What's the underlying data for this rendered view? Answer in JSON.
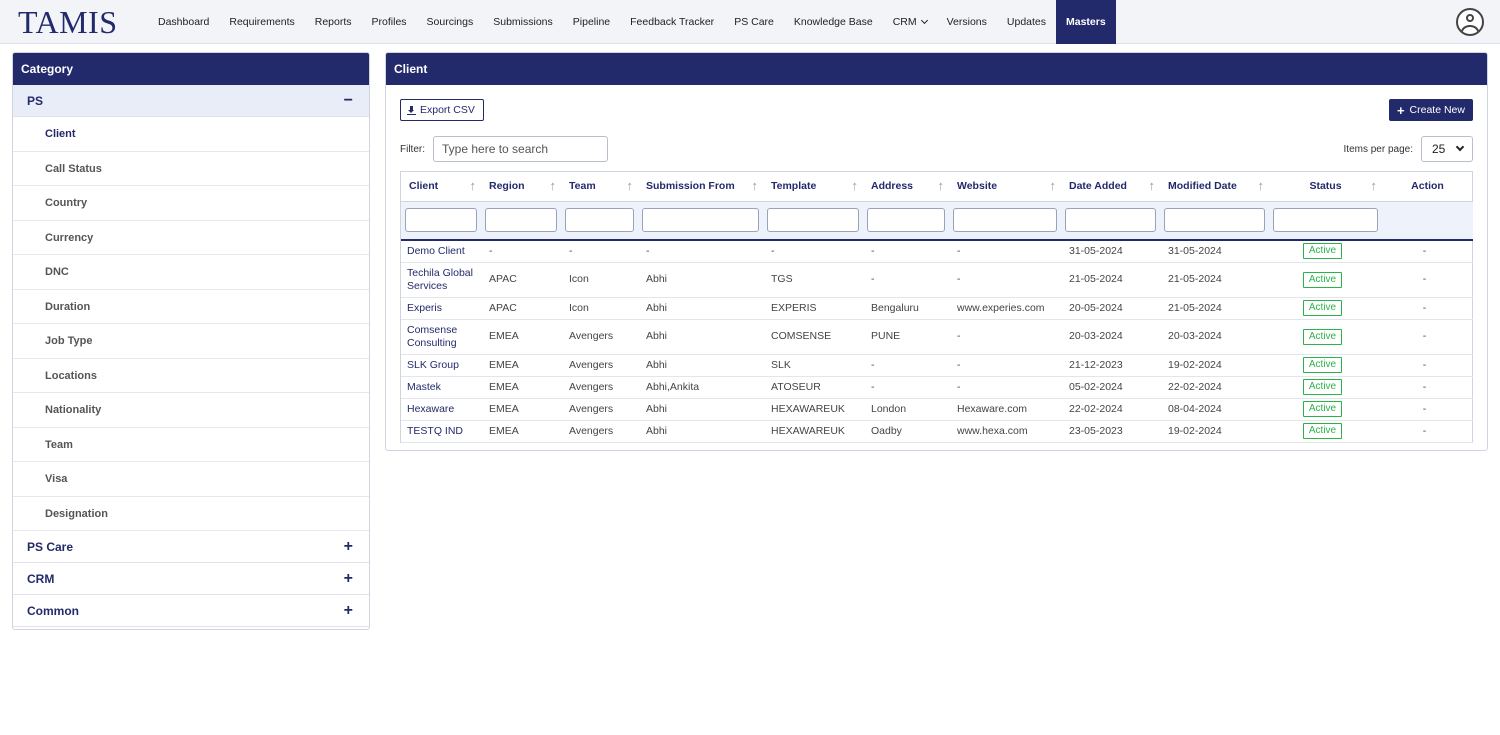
{
  "app": {
    "logo": "TAMIS"
  },
  "nav": [
    {
      "label": "Dashboard"
    },
    {
      "label": "Requirements"
    },
    {
      "label": "Reports"
    },
    {
      "label": "Profiles"
    },
    {
      "label": "Sourcings"
    },
    {
      "label": "Submissions"
    },
    {
      "label": "Pipeline"
    },
    {
      "label": "Feedback Tracker"
    },
    {
      "label": "PS Care"
    },
    {
      "label": "Knowledge Base"
    },
    {
      "label": "CRM"
    },
    {
      "label": "Versions"
    },
    {
      "label": "Updates"
    },
    {
      "label": "Masters"
    }
  ],
  "sidebar": {
    "title": "Category",
    "groups": [
      {
        "label": "PS",
        "toggle": "−",
        "items": [
          "Client",
          "Call Status",
          "Country",
          "Currency",
          "DNC",
          "Duration",
          "Job Type",
          "Locations",
          "Nationality",
          "Team",
          "Visa",
          "Designation"
        ]
      },
      {
        "label": "PS Care",
        "toggle": "+"
      },
      {
        "label": "CRM",
        "toggle": "+"
      },
      {
        "label": "Common",
        "toggle": "+"
      }
    ]
  },
  "main": {
    "title": "Client",
    "export_label": "Export CSV",
    "create_label": "Create New",
    "filter_label": "Filter:",
    "filter_placeholder": "Type here to search",
    "items_per_page_label": "Items per page:",
    "items_per_page_value": "25",
    "sort_glyph": "↑",
    "columns": [
      "Client",
      "Region",
      "Team",
      "Submission From",
      "Template",
      "Address",
      "Website",
      "Date Added",
      "Modified Date",
      "Status",
      "Action"
    ],
    "rows": [
      [
        "Demo Client",
        "-",
        "-",
        "-",
        "-",
        "-",
        "-",
        "31-05-2024",
        "31-05-2024",
        "Active",
        "-"
      ],
      [
        "Techila Global Services",
        "APAC",
        "Icon",
        "Abhi",
        "TGS",
        "-",
        "-",
        "21-05-2024",
        "21-05-2024",
        "Active",
        "-"
      ],
      [
        "Experis",
        "APAC",
        "Icon",
        "Abhi",
        "EXPERIS",
        "Bengaluru",
        "www.experies.com",
        "20-05-2024",
        "21-05-2024",
        "Active",
        "-"
      ],
      [
        "Comsense Consulting",
        "EMEA",
        "Avengers",
        "Abhi",
        "COMSENSE",
        "PUNE",
        "-",
        "20-03-2024",
        "20-03-2024",
        "Active",
        "-"
      ],
      [
        "SLK Group",
        "EMEA",
        "Avengers",
        "Abhi",
        "SLK",
        "-",
        "-",
        "21-12-2023",
        "19-02-2024",
        "Active",
        "-"
      ],
      [
        "Mastek",
        "EMEA",
        "Avengers",
        "Abhi,Ankita",
        "ATOSEUR",
        "-",
        "-",
        "05-02-2024",
        "22-02-2024",
        "Active",
        "-"
      ],
      [
        "Hexaware",
        "EMEA",
        "Avengers",
        "Abhi",
        "HEXAWAREUK",
        "London",
        "Hexaware.com",
        "22-02-2024",
        "08-04-2024",
        "Active",
        "-"
      ],
      [
        "TESTQ IND",
        "EMEA",
        "Avengers",
        "Abhi",
        "HEXAWAREUK",
        "Oadby",
        "www.hexa.com",
        "23-05-2023",
        "19-02-2024",
        "Active",
        "-"
      ]
    ]
  },
  "colors": {
    "primary": "#232a6b",
    "active_status": "#2bb34a"
  }
}
